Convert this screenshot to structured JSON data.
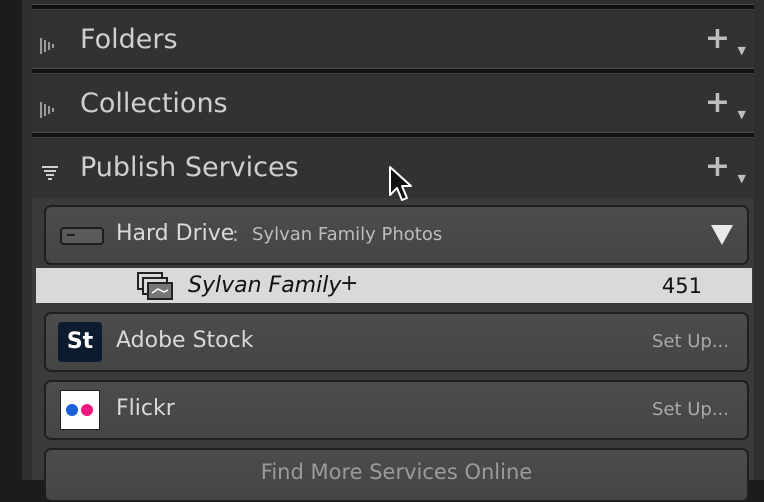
{
  "sections": {
    "folders": {
      "title": "Folders"
    },
    "collections": {
      "title": "Collections"
    },
    "publish_services": {
      "title": "Publish Services"
    }
  },
  "add_glyph": "+",
  "hard_drive": {
    "label": "Hard Drive",
    "separator": " : ",
    "subtitle": "Sylvan Family Photos",
    "collection": {
      "name": "Sylvan Family",
      "plus": "+",
      "count": "451"
    }
  },
  "services": [
    {
      "name": "Adobe Stock",
      "action": "Set Up...",
      "logo_text": "St"
    },
    {
      "name": "Flickr",
      "action": "Set Up..."
    }
  ],
  "find_more": "Find More Services Online",
  "colors": {
    "panel": "#2f2f2f",
    "selected_row": "#d9d9d9",
    "stock_logo": "#0c1b2f",
    "flickr_blue": "#1b5fd8",
    "flickr_pink": "#f0177e"
  }
}
